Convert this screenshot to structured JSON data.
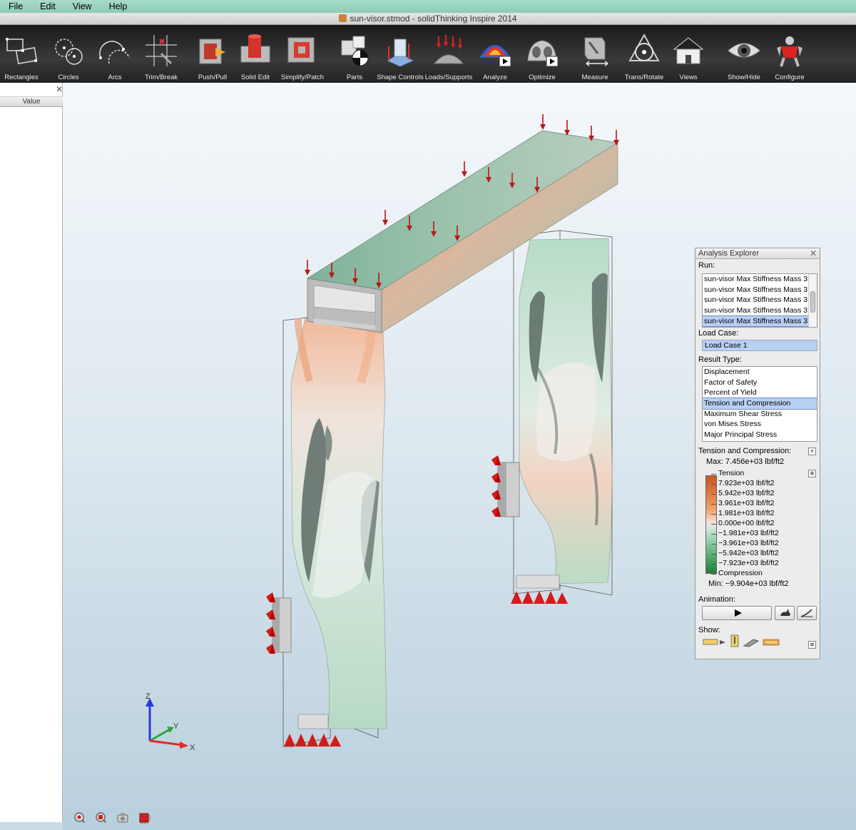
{
  "menu": [
    "File",
    "Edit",
    "View",
    "Help"
  ],
  "window_title": "sun-visor.stmod - solidThinking Inspire 2014",
  "toolbar": [
    {
      "label": "Rectangles",
      "icon": "rectangles-icon"
    },
    {
      "label": "Circles",
      "icon": "circles-icon"
    },
    {
      "label": "Arcs",
      "icon": "arcs-icon"
    },
    {
      "label": "Trim/Break",
      "icon": "trim-break-icon"
    },
    {
      "label": "Push/Pull",
      "icon": "push-pull-icon"
    },
    {
      "label": "Solid Edit",
      "icon": "solid-edit-icon"
    },
    {
      "label": "Simplify/Patch",
      "icon": "simplify-patch-icon"
    },
    {
      "label": "Parts",
      "icon": "parts-icon"
    },
    {
      "label": "Shape Controls",
      "icon": "shape-controls-icon"
    },
    {
      "label": "Loads/Supports",
      "icon": "loads-supports-icon"
    },
    {
      "label": "Analyze",
      "icon": "analyze-icon"
    },
    {
      "label": "Optimize",
      "icon": "optimize-icon"
    },
    {
      "label": "Measure",
      "icon": "measure-icon"
    },
    {
      "label": "Trans/Rotate",
      "icon": "trans-rotate-icon"
    },
    {
      "label": "Views",
      "icon": "views-icon"
    },
    {
      "label": "Show/Hide",
      "icon": "show-hide-icon"
    },
    {
      "label": "Configure",
      "icon": "configure-icon"
    }
  ],
  "left_panel": {
    "column_header": "Value"
  },
  "axes": {
    "z": "Z",
    "y": "Y",
    "x": "X"
  },
  "explorer": {
    "title": "Analysis Explorer",
    "run_label": "Run:",
    "runs": [
      "sun-visor Max Stiffness Mass 3",
      "sun-visor Max Stiffness Mass 3",
      "sun-visor Max Stiffness Mass 3",
      "sun-visor Max Stiffness Mass 3",
      "sun-visor Max Stiffness Mass 3"
    ],
    "selected_run_index": 4,
    "load_case_label": "Load Case:",
    "load_case_value": "Load Case 1",
    "result_type_label": "Result Type:",
    "result_types": [
      "Displacement",
      "Factor of Safety",
      "Percent of Yield",
      "Tension and Compression",
      "Maximum Shear Stress",
      "von Mises Stress",
      "Major Principal Stress"
    ],
    "selected_result_index": 3,
    "legend_title": "Tension and Compression:",
    "max_text": "Max:  7.456e+03 lbf/ft2",
    "legend": [
      "Tension",
      "7.923e+03 lbf/ft2",
      "5.942e+03 lbf/ft2",
      "3.961e+03 lbf/ft2",
      "1.981e+03 lbf/ft2",
      "0.000e+00 lbf/ft2",
      "−1.981e+03 lbf/ft2",
      "−3.961e+03 lbf/ft2",
      "−5.942e+03 lbf/ft2",
      "−7.923e+03 lbf/ft2",
      "Compression"
    ],
    "min_text": "Min:  −9.904e+03 lbf/ft2",
    "animation_label": "Animation:",
    "show_label": "Show:"
  },
  "colors": {
    "tension": "#e07a3e",
    "compression": "#2e8b46",
    "neutral": "#e6e6e6",
    "load_arrow": "#c01818",
    "toolbar_bg": "#2a2a2a"
  }
}
